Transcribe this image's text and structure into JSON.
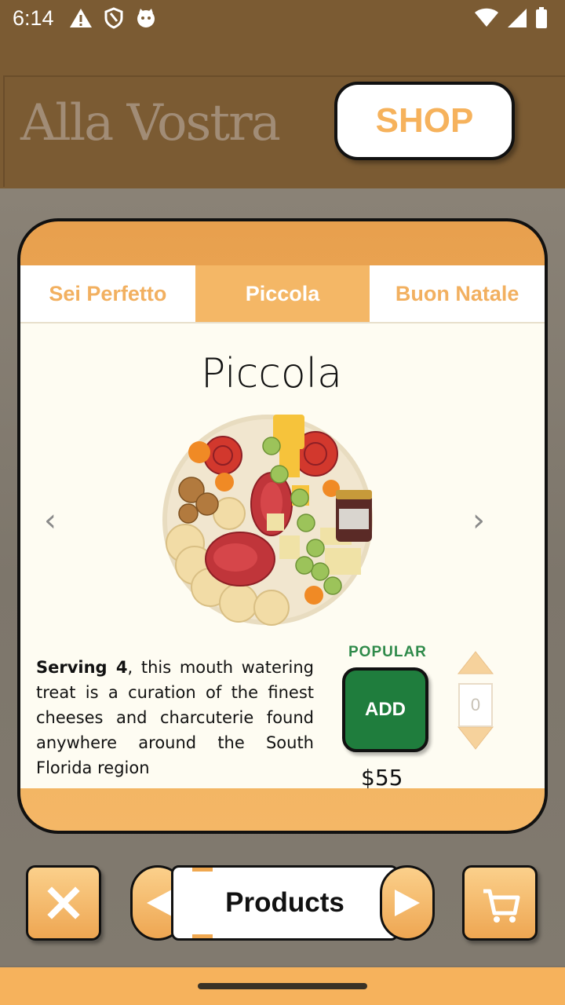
{
  "status_bar": {
    "time": "6:14",
    "left_icons": [
      "warning-icon",
      "shield-icon",
      "cat-icon"
    ],
    "right_icons": [
      "wifi-icon",
      "signal-icon",
      "battery-icon"
    ]
  },
  "header": {
    "brand": "Alla Vostra",
    "shop_label": "SHOP"
  },
  "tabs": [
    {
      "label": "Sei Perfetto",
      "active": false
    },
    {
      "label": "Piccola",
      "active": true
    },
    {
      "label": "Buon Natale",
      "active": false
    }
  ],
  "product": {
    "title": "Piccola",
    "description_bold": "Serving 4",
    "description_rest": ", this mouth watering treat is a curation of the finest cheeses and charcuterie found anywhere around the South Florida region",
    "badge": "POPULAR",
    "add_label": "ADD",
    "price": "$55",
    "quantity": "0",
    "prev_glyph": "‹",
    "next_glyph": "›"
  },
  "bottom_nav": {
    "label": "Products",
    "close_icon": "close-icon",
    "cart_icon": "cart-icon"
  },
  "colors": {
    "brown": "#7b5b33",
    "orange": "#f4b766",
    "green": "#1f7d3d",
    "cream": "#fefcf2"
  }
}
